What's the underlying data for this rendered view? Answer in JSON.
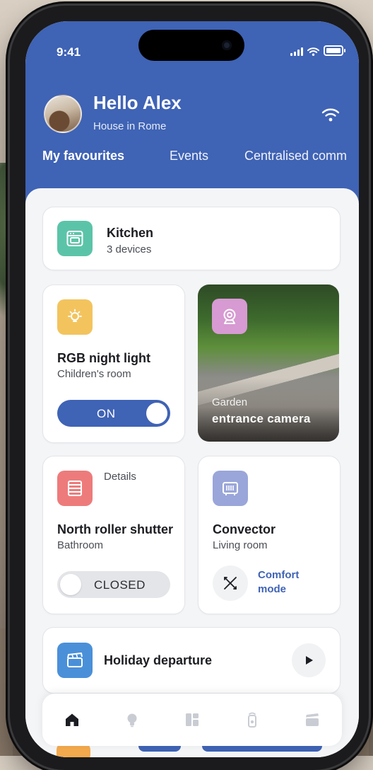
{
  "status": {
    "time": "9:41"
  },
  "header": {
    "greeting": "Hello Alex",
    "location": "House in Rome",
    "tabs": [
      {
        "label": "My favourites",
        "active": true
      },
      {
        "label": "Events",
        "active": false
      },
      {
        "label": "Centralised comm",
        "active": false
      }
    ]
  },
  "cards": {
    "kitchen": {
      "title": "Kitchen",
      "subtitle": "3 devices",
      "color": "#5bc4a8"
    },
    "rgb": {
      "title": "RGB night light",
      "subtitle": "Children's room",
      "toggle": "ON",
      "color": "#f3c45e"
    },
    "camera": {
      "line1": "Garden",
      "line2": "entrance camera",
      "color": "#d79ad2"
    },
    "shutter": {
      "title": "North roller shutter",
      "subtitle": "Bathroom",
      "details": "Details",
      "toggle": "CLOSED",
      "color": "#ee7b7b"
    },
    "convector": {
      "title": "Convector",
      "subtitle": "Living room",
      "mode_line1": "Comfort",
      "mode_line2": "mode",
      "color": "#9aa6d9"
    },
    "holiday": {
      "title": "Holiday departure",
      "color": "#4a90d9"
    }
  },
  "nav": {
    "items": [
      {
        "icon": "home-icon",
        "active": true
      },
      {
        "icon": "bulb-icon",
        "active": false
      },
      {
        "icon": "dashboard-icon",
        "active": false
      },
      {
        "icon": "remote-icon",
        "active": false
      },
      {
        "icon": "clapper-icon",
        "active": false
      }
    ]
  },
  "colors": {
    "primary": "#3f63b5",
    "background": "#f4f5f7"
  }
}
